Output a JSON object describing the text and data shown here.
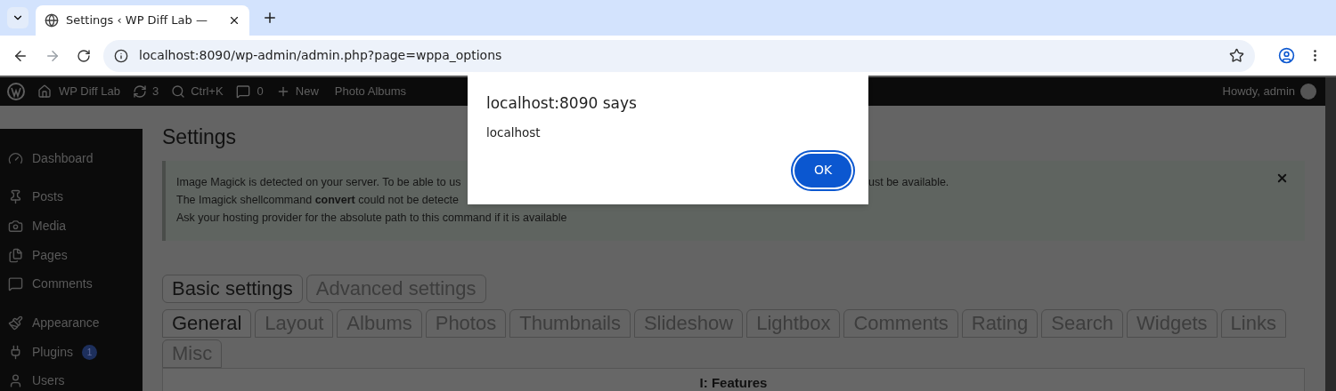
{
  "browser": {
    "tab_title": "Settings ‹ WP Diff Lab — ",
    "url": "localhost:8090/wp-admin/admin.php?page=wppa_options"
  },
  "admin_bar": {
    "site": "WP Diff Lab",
    "updates": "3",
    "search": "Ctrl+K",
    "comments": "0",
    "new": "New",
    "photo_albums": "Photo Albums",
    "howdy": "Howdy, admin"
  },
  "sidebar": {
    "items": [
      {
        "kind": "dashboard",
        "label": "Dashboard"
      },
      {
        "kind": "posts",
        "label": "Posts"
      },
      {
        "kind": "media",
        "label": "Media"
      },
      {
        "kind": "pages",
        "label": "Pages"
      },
      {
        "kind": "comments",
        "label": "Comments"
      },
      {
        "kind": "appearance",
        "label": "Appearance"
      },
      {
        "kind": "plugins",
        "label": "Plugins",
        "badge": "1"
      },
      {
        "kind": "users",
        "label": "Users"
      }
    ]
  },
  "page_title": "Settings",
  "notice": {
    "line_1_start": "Image Magick is detected on your server. To be able to us",
    "line_1_end": "ust be available.",
    "line_2": "The Imagick shellcommand **convert** could not be detecte",
    "line_3": "Ask your hosting provider for the absolute path to this command if it is available"
  },
  "settings_tabs": [
    {
      "label": "Basic settings",
      "selected": true
    },
    {
      "label": "Advanced settings",
      "selected": false
    }
  ],
  "section_tabs": [
    {
      "label": "General",
      "selected": true
    },
    {
      "label": "Layout",
      "selected": false
    },
    {
      "label": "Albums",
      "selected": false
    },
    {
      "label": "Photos",
      "selected": false
    },
    {
      "label": "Thumbnails",
      "selected": false
    },
    {
      "label": "Slideshow",
      "selected": false
    },
    {
      "label": "Lightbox",
      "selected": false
    },
    {
      "label": "Comments",
      "selected": false
    },
    {
      "label": "Rating",
      "selected": false
    },
    {
      "label": "Search",
      "selected": false
    },
    {
      "label": "Widgets",
      "selected": false
    },
    {
      "label": "Links",
      "selected": false
    },
    {
      "label": "Misc",
      "selected": false
    }
  ],
  "table": {
    "heading": "I: Features"
  },
  "dialog": {
    "title": "localhost:8090 says",
    "message": "localhost",
    "button": "OK"
  }
}
